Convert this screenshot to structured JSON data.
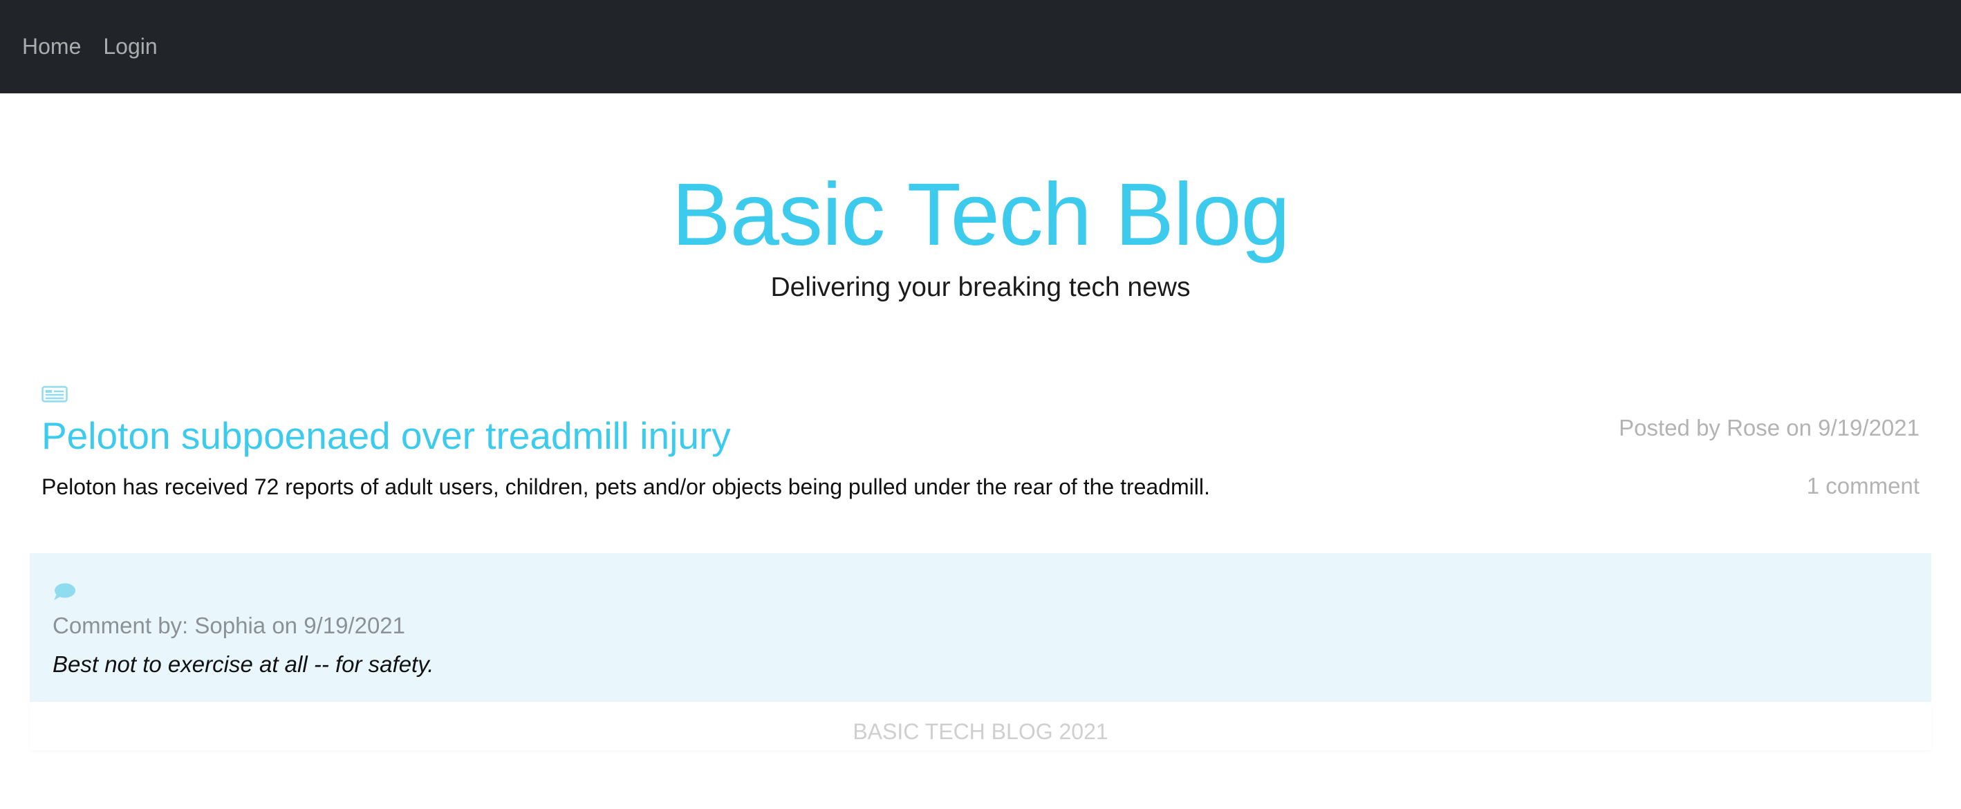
{
  "navbar": {
    "links": [
      {
        "label": "Home"
      },
      {
        "label": "Login"
      }
    ]
  },
  "hero": {
    "title": "Basic Tech Blog",
    "subtitle": "Delivering your breaking tech news"
  },
  "post": {
    "icon": "newspaper-icon",
    "title": "Peloton subpoenaed over treadmill injury",
    "meta": "Posted by Rose on 9/19/2021",
    "body": "Peloton has received 72 reports of adult users, children, pets and/or objects being pulled under the rear of the treadmill.",
    "comments_label": "1 comment"
  },
  "comment": {
    "icon": "speech-bubble-icon",
    "meta": "Comment by: Sophia on 9/19/2021",
    "text": "Best not to exercise at all -- for safety."
  },
  "footer": {
    "text": "BASIC TECH BLOG 2021"
  },
  "colors": {
    "navbar_bg": "#212529",
    "accent": "#3ccbec",
    "comment_bg": "#e9f7fc"
  }
}
